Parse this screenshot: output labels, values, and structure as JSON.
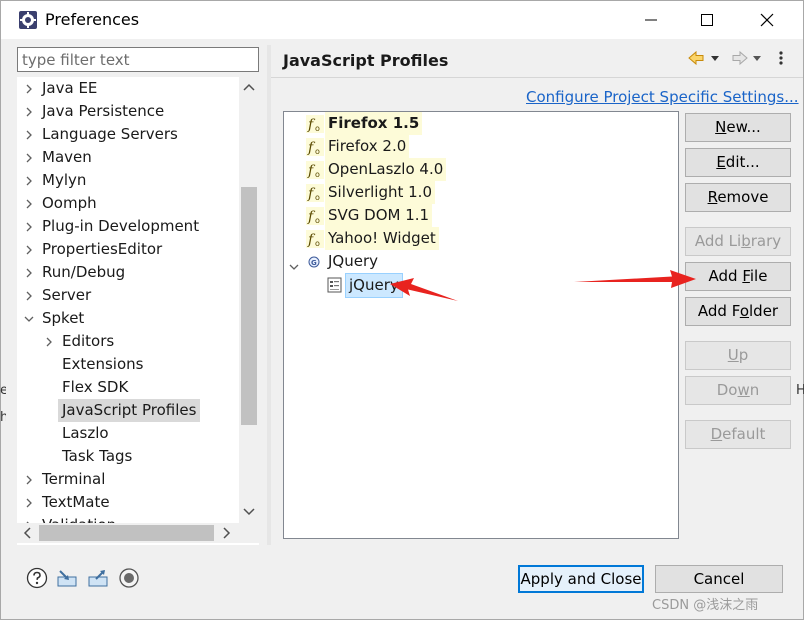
{
  "window": {
    "title": "Preferences"
  },
  "filter": {
    "placeholder": "type filter text"
  },
  "tree": {
    "items": [
      {
        "label": "Java EE",
        "level": 0,
        "expander": "collapsed"
      },
      {
        "label": "Java Persistence",
        "level": 0,
        "expander": "collapsed"
      },
      {
        "label": "Language Servers",
        "level": 0,
        "expander": "collapsed"
      },
      {
        "label": "Maven",
        "level": 0,
        "expander": "collapsed"
      },
      {
        "label": "Mylyn",
        "level": 0,
        "expander": "collapsed"
      },
      {
        "label": "Oomph",
        "level": 0,
        "expander": "collapsed"
      },
      {
        "label": "Plug-in Development",
        "level": 0,
        "expander": "collapsed"
      },
      {
        "label": "PropertiesEditor",
        "level": 0,
        "expander": "collapsed"
      },
      {
        "label": "Run/Debug",
        "level": 0,
        "expander": "collapsed"
      },
      {
        "label": "Server",
        "level": 0,
        "expander": "collapsed"
      },
      {
        "label": "Spket",
        "level": 0,
        "expander": "expanded"
      },
      {
        "label": "Editors",
        "level": 1,
        "expander": "collapsed"
      },
      {
        "label": "Extensions",
        "level": 1,
        "expander": "none"
      },
      {
        "label": "Flex SDK",
        "level": 1,
        "expander": "none"
      },
      {
        "label": "JavaScript Profiles",
        "level": 1,
        "expander": "none",
        "selected": true
      },
      {
        "label": "Laszlo",
        "level": 1,
        "expander": "none"
      },
      {
        "label": "Task Tags",
        "level": 1,
        "expander": "none"
      },
      {
        "label": "Terminal",
        "level": 0,
        "expander": "collapsed"
      },
      {
        "label": "TextMate",
        "level": 0,
        "expander": "collapsed"
      },
      {
        "label": "Validation",
        "level": 0,
        "expander": "collapsed"
      }
    ]
  },
  "page": {
    "title": "JavaScript Profiles",
    "config_link": "Configure Project Specific Settings..."
  },
  "profiles": [
    {
      "label": "Firefox 1.5",
      "bold": true,
      "highlight": true,
      "level": 0,
      "icon": "function-icon"
    },
    {
      "label": "Firefox 2.0",
      "highlight": true,
      "level": 0,
      "icon": "function-icon"
    },
    {
      "label": "OpenLaszlo 4.0",
      "highlight": true,
      "level": 0,
      "icon": "function-icon"
    },
    {
      "label": "Silverlight 1.0",
      "highlight": true,
      "level": 0,
      "icon": "function-icon"
    },
    {
      "label": "SVG DOM 1.1",
      "highlight": true,
      "level": 0,
      "icon": "function-icon"
    },
    {
      "label": "Yahoo! Widget",
      "highlight": true,
      "level": 0,
      "icon": "function-icon"
    },
    {
      "label": "JQuery",
      "level": 0,
      "icon": "group-icon",
      "expander": "expanded"
    },
    {
      "label": "jQuery",
      "level": 1,
      "icon": "library-icon",
      "selected": true
    }
  ],
  "buttons": [
    {
      "pre": "",
      "mn": "N",
      "post": "ew...",
      "enabled": true
    },
    {
      "pre": "",
      "mn": "E",
      "post": "dit...",
      "enabled": true
    },
    {
      "pre": "",
      "mn": "R",
      "post": "emove",
      "enabled": true
    },
    {
      "pre": "Add Li",
      "mn": "b",
      "post": "rary",
      "enabled": false
    },
    {
      "pre": "Add ",
      "mn": "F",
      "post": "ile",
      "enabled": true
    },
    {
      "pre": "Add F",
      "mn": "o",
      "post": "lder",
      "enabled": true
    },
    {
      "pre": "",
      "mn": "U",
      "post": "p",
      "enabled": false
    },
    {
      "pre": "Do",
      "mn": "w",
      "post": "n",
      "enabled": false
    },
    {
      "pre": "",
      "mn": "D",
      "post": "efault",
      "enabled": false
    }
  ],
  "footer": {
    "apply_label": "Apply and Close",
    "cancel_label": "Cancel"
  },
  "watermark": "CSDN @浅沫之雨",
  "colors": {
    "accent": "#0078d7",
    "link": "#1a64c8",
    "annotation": "#e8231f",
    "highlight": "#fdfbd8"
  }
}
